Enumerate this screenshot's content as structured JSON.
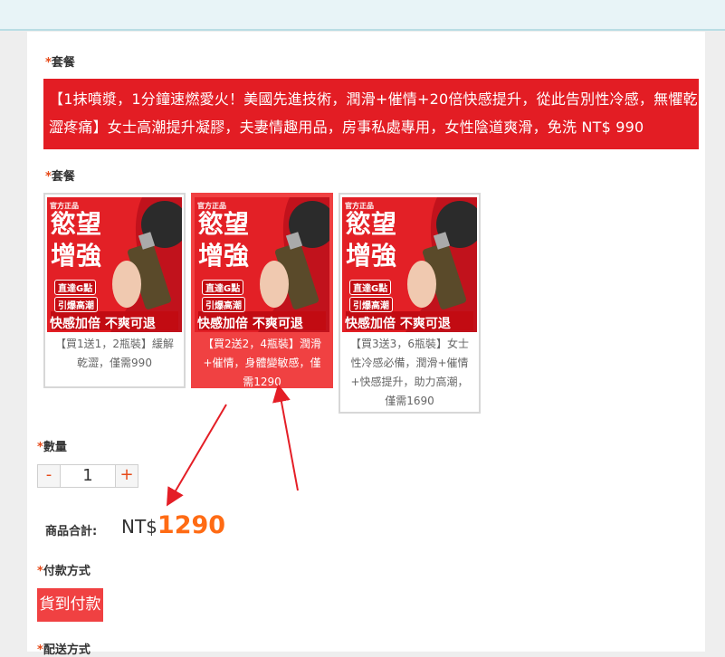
{
  "labels": {
    "package_1": "套餐",
    "package_2": "套餐",
    "quantity": "數量",
    "payment": "付款方式",
    "shipping": "配送方式",
    "required_star": "*"
  },
  "package_banner": "【1抹噴漿，1分鐘速燃愛火！美國先進技術，潤滑+催情+20倍快感提升，從此告別性冷感，無懼乾澀疼痛】女士高潮提升凝膠，夫妻情趣用品，房事私處專用，女性陰道爽滑，免洗 NT$ 990",
  "product_image": {
    "badge": "官方正品",
    "headline_1": "慾望",
    "headline_2": "增強",
    "tag_1": "直達G點",
    "tag_2": "引爆高潮",
    "footer": "快感加倍 不爽可退",
    "colors": {
      "background": "#e32026",
      "model": "#c1121c",
      "bottle": "#5a4a2a"
    }
  },
  "options": [
    {
      "caption": "【買1送1，2瓶裝】緩解乾澀，僅需990",
      "selected": false
    },
    {
      "caption": "【買2送2，4瓶裝】潤滑+催情，身體變敏感，僅需1290",
      "selected": true
    },
    {
      "caption": "【買3送3，6瓶裝】女士性冷感必備，潤滑+催情+快感提升，助力高潮，僅需1690",
      "selected": false
    }
  ],
  "quantity": {
    "minus": "-",
    "value": "1",
    "plus": "+"
  },
  "total": {
    "label": "商品合計:",
    "currency": "NT$",
    "amount": "1290"
  },
  "payment_method": "貨到付款",
  "colors": {
    "accent": "#f04142",
    "banner": "#e31d24",
    "price": "#ff6b14",
    "star": "#e64a19"
  }
}
